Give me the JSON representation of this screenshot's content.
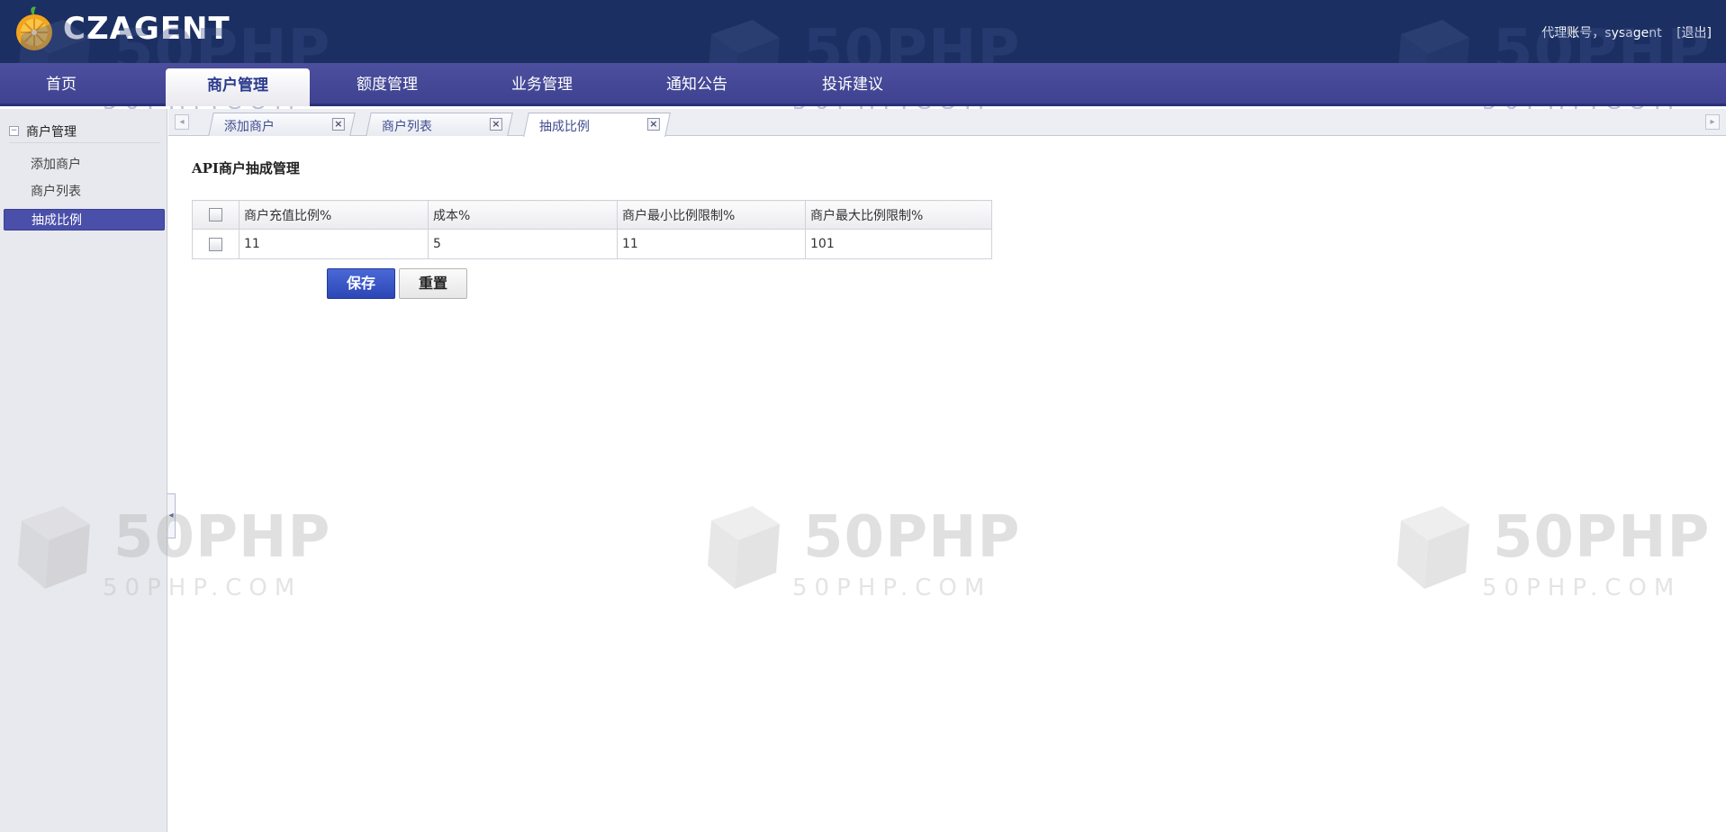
{
  "brand": {
    "name": "CZAGENT"
  },
  "user": {
    "label": "代理账号，sysagent",
    "logout": "[退出]"
  },
  "nav": {
    "items": [
      {
        "label": "首页"
      },
      {
        "label": "商户管理"
      },
      {
        "label": "额度管理"
      },
      {
        "label": "业务管理"
      },
      {
        "label": "通知公告"
      },
      {
        "label": "投诉建议"
      }
    ],
    "active": "商户管理"
  },
  "sidebar": {
    "group": "商户管理",
    "items": [
      {
        "label": "添加商户"
      },
      {
        "label": "商户列表"
      },
      {
        "label": "抽成比例"
      }
    ],
    "active": "抽成比例"
  },
  "tabs": [
    {
      "label": "添加商户"
    },
    {
      "label": "商户列表"
    },
    {
      "label": "抽成比例"
    }
  ],
  "active_tab": "抽成比例",
  "content": {
    "title": "API商户抽成管理",
    "table": {
      "headers": [
        "商户充值比例%",
        "成本%",
        "商户最小比例限制%",
        "商户最大比例限制%"
      ],
      "rows": [
        [
          "11",
          "5",
          "11",
          "101"
        ]
      ]
    },
    "buttons": {
      "save": "保存",
      "reset": "重置"
    }
  },
  "watermark": {
    "big": "50PHP",
    "small": "50PHP.COM"
  },
  "colors": {
    "header": "#1b2f63",
    "nav": "#4c4f9e",
    "accent": "#4a4fa9",
    "save_button": "#2c46b5"
  }
}
